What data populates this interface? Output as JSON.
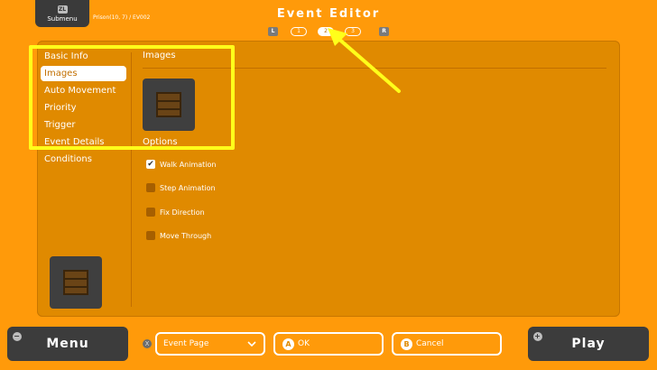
{
  "header": {
    "submenu_key": "ZL",
    "submenu_label": "Submenu",
    "location": "Prison(10, 7) / EV002",
    "title": "Event Editor",
    "pager": {
      "left_key": "L",
      "right_key": "R",
      "pages": [
        "1",
        "2",
        "3"
      ],
      "active_page": "2"
    }
  },
  "sidebar": {
    "items": [
      {
        "label": "Basic Info"
      },
      {
        "label": "Images"
      },
      {
        "label": "Auto Movement"
      },
      {
        "label": "Priority"
      },
      {
        "label": "Trigger"
      },
      {
        "label": "Event Details"
      },
      {
        "label": "Conditions"
      }
    ],
    "selected": "Images"
  },
  "main": {
    "images_title": "Images",
    "options_title": "Options",
    "options": [
      {
        "label": "Walk Animation",
        "checked": true
      },
      {
        "label": "Step Animation",
        "checked": false
      },
      {
        "label": "Fix Direction",
        "checked": false
      },
      {
        "label": "Move Through",
        "checked": false
      }
    ]
  },
  "footer": {
    "menu_label": "Menu",
    "menu_key": "−",
    "event_page_key": "X",
    "event_page_label": "Event Page",
    "ok_key": "A",
    "ok_label": "OK",
    "cancel_key": "B",
    "cancel_label": "Cancel",
    "play_label": "Play",
    "play_key": "+"
  },
  "colors": {
    "background": "#ff9a0a",
    "panel": "#e08a00",
    "highlight": "#ffff1a",
    "dark_button": "#3c3c3c"
  }
}
